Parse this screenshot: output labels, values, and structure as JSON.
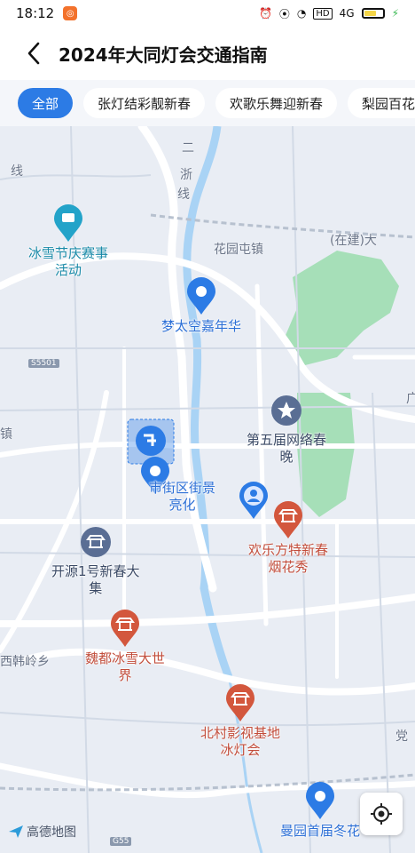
{
  "status_bar": {
    "time": "18:12",
    "network": "4G",
    "hd": "HD"
  },
  "header": {
    "title": "2024年大同灯会交通指南"
  },
  "filters": [
    {
      "label": "全部",
      "active": true
    },
    {
      "label": "张灯结彩靓新春",
      "active": false
    },
    {
      "label": "欢歌乐舞迎新春",
      "active": false
    },
    {
      "label": "梨园百花",
      "active": false
    }
  ],
  "map": {
    "labels": {
      "huayuantun": "花园屯镇",
      "zaijian": "(在建)大",
      "line2": "二",
      "line2b": "浙",
      "line2c": "线",
      "xian": "线",
      "zhen": "镇",
      "xihanling": "西韩岭乡",
      "dang": "党",
      "guang": "广",
      "s5501": "S5501",
      "g55": "G55"
    },
    "pois": [
      {
        "name": "冰雪节庆赛事\n活动",
        "color": "teal"
      },
      {
        "name": "梦太空嘉年华",
        "color": "blue"
      },
      {
        "name": "第五届网络春\n晚",
        "color": "dark"
      },
      {
        "name": "市街区街景\n亮化",
        "color": "blue"
      },
      {
        "name": "欢乐方特新春\n烟花秀",
        "color": "red"
      },
      {
        "name": "开源1号新春大\n集",
        "color": "dark"
      },
      {
        "name": "魏都冰雪大世\n界",
        "color": "red"
      },
      {
        "name": "北村影视基地\n冰灯会",
        "color": "red"
      },
      {
        "name": "曼园首届冬花",
        "color": "blue"
      }
    ],
    "brand": "高德地图"
  },
  "colors": {
    "accent": "#2c7be5",
    "water": "#a9d3f5",
    "park": "#9cdcb0",
    "road": "#ffffff"
  }
}
